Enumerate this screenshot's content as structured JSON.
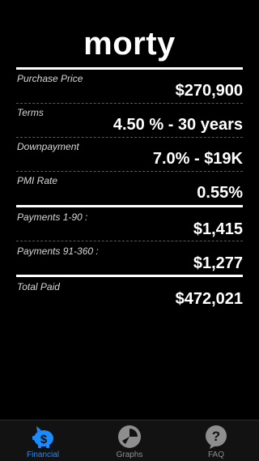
{
  "app": {
    "title": "morty"
  },
  "rows": [
    {
      "label": "Purchase Price",
      "value": "$270,900"
    },
    {
      "label": "Terms",
      "value": "4.50 % - 30 years"
    },
    {
      "label": "Downpayment",
      "value": "7.0% - $19K"
    },
    {
      "label": "PMI Rate",
      "value": "0.55%"
    },
    {
      "label": "Payments 1-90 :",
      "value": "$1,415"
    },
    {
      "label": "Payments 91-360 :",
      "value": "$1,277"
    },
    {
      "label": "Total Paid",
      "value": "$472,021"
    }
  ],
  "tabs": [
    {
      "label": "Financial",
      "icon": "piggy-bank-dollar-icon",
      "selected": true
    },
    {
      "label": "Graphs",
      "icon": "pie-chart-icon",
      "selected": false
    },
    {
      "label": "FAQ",
      "icon": "question-bubble-icon",
      "selected": false
    }
  ],
  "colors": {
    "background": "#000000",
    "text": "#ffffff",
    "accent": "#1a8cff",
    "tab_inactive": "#8e8e8e",
    "tab_bar": "#121212"
  }
}
